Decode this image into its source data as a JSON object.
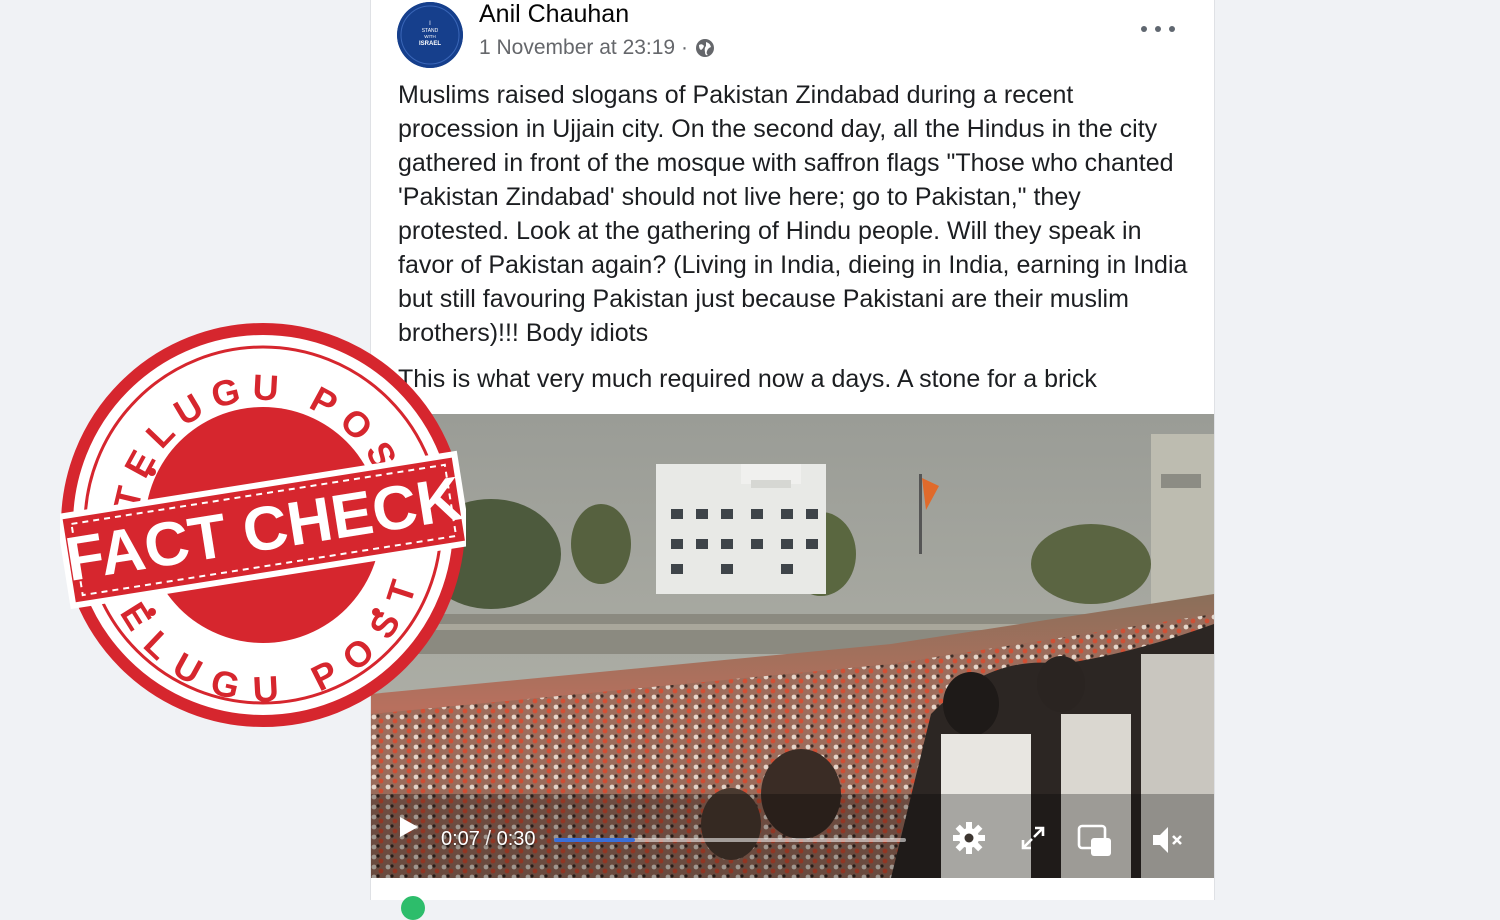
{
  "post": {
    "author": "Anil Chauhan",
    "timestamp": "1 November at 23:19 ·",
    "avatar_text": [
      "I",
      "STAND",
      "WITH",
      "ISRAEL"
    ],
    "privacy_icon": "globe-icon",
    "menu_icon": "more-options-icon",
    "text_paragraph_1": "Muslims raised slogans of Pakistan Zindabad during a recent procession in Ujjain city.  On the second day, all the Hindus in the city gathered in front of the mosque with saffron flags \"Those who chanted 'Pakistan Zindabad' should not live here; go to Pakistan,\" they protested.  Look at the gathering of Hindu people. Will they speak in favor of Pakistan again? (Living in India, dieing in India,  earning in India but still favouring Pakistan just because Pakistani are their muslim brothers)!!! Body idiots",
    "text_paragraph_2": "This is what very much required now a days. A stone for a brick"
  },
  "video": {
    "current_time": "0:07",
    "separator": " / ",
    "duration": "0:30",
    "progress_fraction": 0.23,
    "icons": [
      "play-icon",
      "settings-gear-icon",
      "fullscreen-icon",
      "picture-in-picture-icon",
      "volume-muted-icon"
    ],
    "accent_color": "#3a6fd8"
  },
  "stamp": {
    "top_text": "TELUGU POST",
    "middle_text": "FACT CHECK",
    "bottom_text": "TELUGU POST",
    "color": "#d6262e"
  }
}
